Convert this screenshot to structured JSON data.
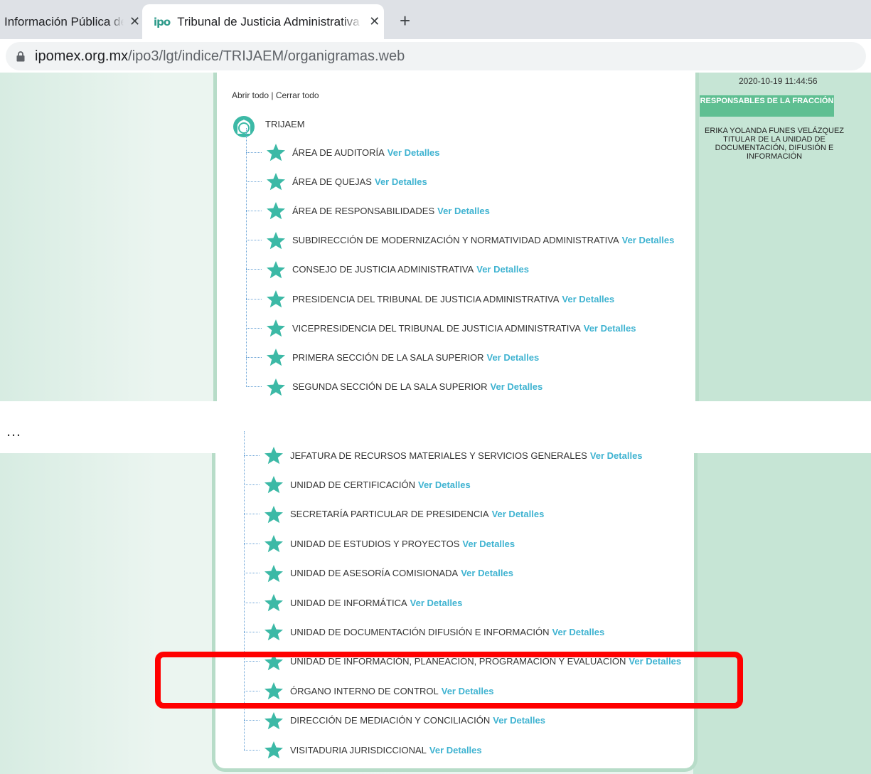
{
  "browser": {
    "tabs": [
      {
        "title": "Información Pública de Oficio Mexiquense",
        "favicon": ""
      },
      {
        "title": "Tribunal de Justicia Administrativa del Estado de México",
        "favicon": "ipo"
      }
    ],
    "close_glyph": "✕",
    "new_tab_glyph": "+",
    "url_host": "ipomex.org.mx",
    "url_path": "/ipo3/lgt/indice/TRIJAEM/organigramas.web"
  },
  "sidebar": {
    "datestamp": "2020-10-19 11:44:56",
    "responsables_header": "RESPONSABLES DE LA FRACCIÓN",
    "responsable": "ERIKA YOLANDA FUNES VELÁZQUEZ TITULAR DE LA UNIDAD DE DOCUMENTACIÓN, DIFUSIÓN E INFORMACIÓN"
  },
  "tree": {
    "open_all": "Abrir todo",
    "separator": " | ",
    "close_all": "Cerrar todo",
    "root": "TRIJAEM",
    "details_label": "Ver Detalles",
    "items_top": [
      "ÁREA DE AUDITORÍA",
      "ÁREA DE QUEJAS",
      "ÁREA DE RESPONSABILIDADES",
      "SUBDIRECCIÓN DE MODERNIZACIÓN Y NORMATIVIDAD ADMINISTRATIVA",
      "CONSEJO DE JUSTICIA ADMINISTRATIVA",
      "PRESIDENCIA DEL TRIBUNAL DE JUSTICIA ADMINISTRATIVA",
      "VICEPRESIDENCIA DEL TRIBUNAL DE JUSTICIA ADMINISTRATIVA",
      "PRIMERA SECCIÓN DE LA SALA SUPERIOR",
      "SEGUNDA SECCIÓN DE LA SALA SUPERIOR"
    ],
    "items_bottom": [
      "JEFATURA DE RECURSOS MATERIALES Y SERVICIOS GENERALES",
      "UNIDAD DE CERTIFICACIÓN",
      "SECRETARÍA PARTICULAR DE PRESIDENCIA",
      "UNIDAD DE ESTUDIOS Y PROYECTOS",
      "UNIDAD DE ASESORÍA COMISIONADA",
      "UNIDAD DE INFORMÁTICA",
      "UNIDAD DE DOCUMENTACIÓN DIFUSIÓN E INFORMACIÓN",
      "UNIDAD DE INFORMACIÓN, PLANEACIÓN, PROGRAMACIÓN Y EVALUACIÓN",
      "ÓRGANO INTERNO DE CONTROL",
      "DIRECCIÓN DE MEDIACIÓN Y CONCILIACIÓN",
      "VISITADURIA JURISDICCIONAL"
    ],
    "highlighted_items": [
      "UNIDAD DE INFORMACIÓN, PLANEACIÓN, PROGRAMACIÓN Y EVALUACIÓN",
      "ÓRGANO INTERNO DE CONTROL"
    ]
  },
  "ellipsis": "…",
  "colors": {
    "star": "#3cb9a6",
    "details_link": "#3fb3d1",
    "sidebar": "#c6e5d5",
    "responsables_header": "#5fbf92",
    "highlight_box": "#ff0000"
  },
  "icons": {
    "lock": "lock-icon",
    "star": "star-icon",
    "root": "organization-root-icon"
  }
}
